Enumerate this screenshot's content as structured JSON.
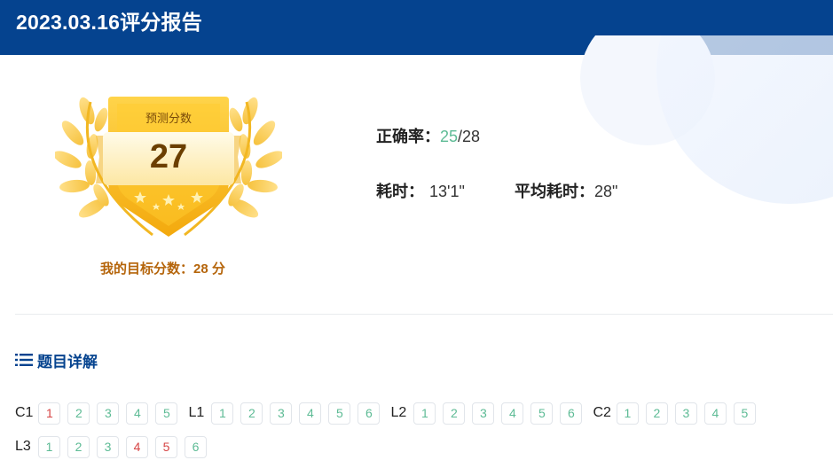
{
  "header": {
    "title": "2023.03.16评分报告"
  },
  "score_card": {
    "badge_label": "预测分数",
    "predicted_score": "27",
    "target_label": "我的目标分数：28 分"
  },
  "stats": {
    "accuracy_label": "正确率：",
    "accuracy_correct": "25",
    "accuracy_total": "/28",
    "time_label": "耗时：",
    "time_value": "13'1\"",
    "avg_time_label": "平均耗时：",
    "avg_time_value": "28\""
  },
  "section": {
    "title": "题目详解"
  },
  "question_groups": [
    {
      "label": "C1",
      "items": [
        {
          "n": "1",
          "status": "wrong"
        },
        {
          "n": "2",
          "status": "correct"
        },
        {
          "n": "3",
          "status": "correct"
        },
        {
          "n": "4",
          "status": "correct"
        },
        {
          "n": "5",
          "status": "correct"
        }
      ]
    },
    {
      "label": "L1",
      "items": [
        {
          "n": "1",
          "status": "correct"
        },
        {
          "n": "2",
          "status": "correct"
        },
        {
          "n": "3",
          "status": "correct"
        },
        {
          "n": "4",
          "status": "correct"
        },
        {
          "n": "5",
          "status": "correct"
        },
        {
          "n": "6",
          "status": "correct"
        }
      ]
    },
    {
      "label": "L2",
      "items": [
        {
          "n": "1",
          "status": "correct"
        },
        {
          "n": "2",
          "status": "correct"
        },
        {
          "n": "3",
          "status": "correct"
        },
        {
          "n": "4",
          "status": "correct"
        },
        {
          "n": "5",
          "status": "correct"
        },
        {
          "n": "6",
          "status": "correct"
        }
      ]
    },
    {
      "label": "C2",
      "items": [
        {
          "n": "1",
          "status": "correct"
        },
        {
          "n": "2",
          "status": "correct"
        },
        {
          "n": "3",
          "status": "correct"
        },
        {
          "n": "4",
          "status": "correct"
        },
        {
          "n": "5",
          "status": "correct"
        }
      ]
    },
    {
      "label": "L3",
      "items": [
        {
          "n": "1",
          "status": "correct"
        },
        {
          "n": "2",
          "status": "correct"
        },
        {
          "n": "3",
          "status": "correct"
        },
        {
          "n": "4",
          "status": "wrong"
        },
        {
          "n": "5",
          "status": "wrong"
        },
        {
          "n": "6",
          "status": "correct"
        }
      ]
    }
  ],
  "colors": {
    "header_bg": "#05438f",
    "correct": "#5dbb95",
    "wrong": "#d64545",
    "gold": "#f5b80f",
    "target_text": "#b5650b"
  },
  "icons": {
    "list": "list-icon",
    "badge": "laurel-shield-badge-icon"
  }
}
